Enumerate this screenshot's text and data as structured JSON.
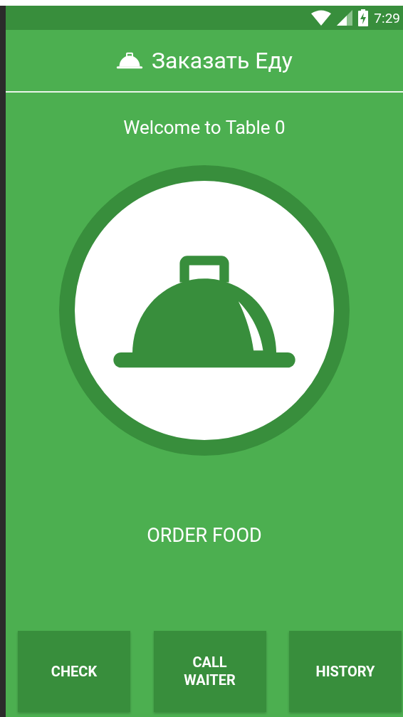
{
  "status_bar": {
    "time": "7:29"
  },
  "app_bar": {
    "title": "Заказать Еду"
  },
  "welcome": "Welcome to Table 0",
  "order_button": {
    "label": "ORDER FOOD"
  },
  "buttons": [
    {
      "label": "CHECK"
    },
    {
      "label": "CALL WAITER"
    },
    {
      "label": "HISTORY"
    }
  ]
}
